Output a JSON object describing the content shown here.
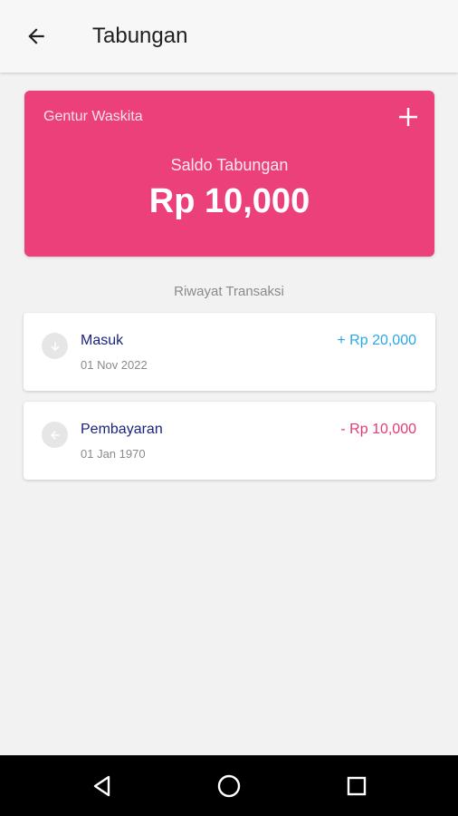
{
  "app_bar": {
    "title": "Tabungan",
    "back_icon": "arrow-left-icon"
  },
  "balance_card": {
    "owner": "Gentur Waskita",
    "label": "Saldo Tabungan",
    "amount": "Rp 10,000",
    "add_icon": "plus-icon",
    "color": "#ec407a"
  },
  "history": {
    "title": "Riwayat Transaksi",
    "items": [
      {
        "type": "Masuk",
        "date": "01 Nov 2022",
        "amount": "+ Rp 20,000",
        "icon": "arrow-down-icon",
        "amount_color": "#29a8e8"
      },
      {
        "type": "Pembayaran",
        "date": "01 Jan 1970",
        "amount": "- Rp 10,000",
        "icon": "arrow-left-icon",
        "amount_color": "#e53a74"
      }
    ]
  },
  "navigation": {
    "back_icon": "triangle-back-icon",
    "home_icon": "circle-home-icon",
    "recents_icon": "square-recents-icon"
  }
}
